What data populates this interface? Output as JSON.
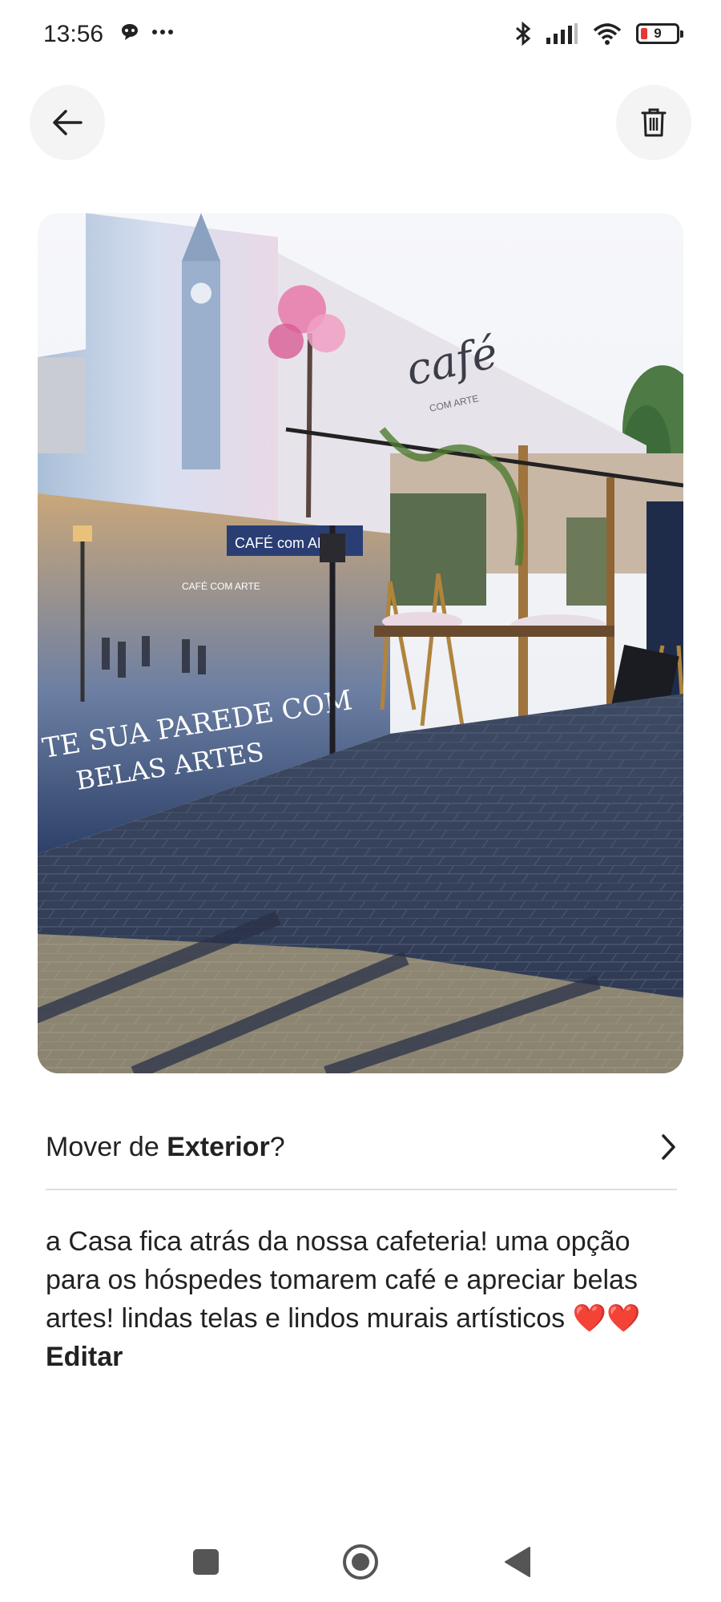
{
  "status_bar": {
    "time": "13:56",
    "battery_level": "9",
    "icons": [
      "messenger-icon",
      "more-dots-icon",
      "bluetooth-icon",
      "signal-icon",
      "wifi-icon",
      "battery-icon"
    ]
  },
  "header": {
    "back_icon": "arrow-left-icon",
    "delete_icon": "trash-icon"
  },
  "photo": {
    "sign_cafe": "café",
    "sign_com_arte": "COM ARTE",
    "mural_sign": "CAFÉ com ARTE",
    "mural_text_line1": "TE SUA PAREDE COM",
    "mural_text_line2": "BELAS ARTES",
    "mural_shop_sign": "CAFÉ COM ARTE"
  },
  "album": {
    "prefix": "Mover de ",
    "name": "Exterior",
    "suffix": "?",
    "chevron_icon": "chevron-right-icon"
  },
  "caption": {
    "text": "a Casa fica atrás da nossa cafeteria! uma opção para os hóspedes tomarem café e apreciar belas artes! lindas telas e lindos murais artísticos ❤️❤️",
    "edit_label": "Editar"
  },
  "nav_bar": {
    "icons": [
      "recents-square-icon",
      "home-circle-icon",
      "back-triangle-icon"
    ]
  },
  "colors": {
    "accent_red": "#e53935",
    "divider": "#dddddd",
    "button_bg": "#f4f4f4",
    "text": "#222222"
  }
}
